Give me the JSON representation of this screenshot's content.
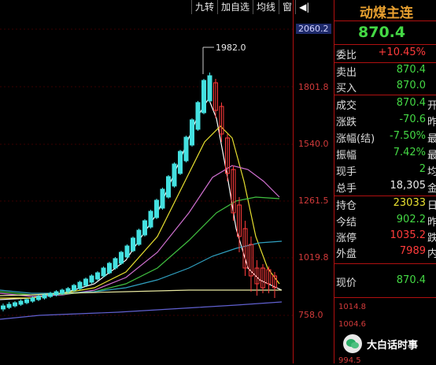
{
  "toolbar": {
    "buttons": [
      "九转",
      "加自选",
      "均线",
      "窗"
    ],
    "arrow": "◀|"
  },
  "axis": {
    "ticks": [
      "2060.2",
      "1801.8",
      "1540.0",
      "1261.5",
      "1019.8",
      "758.0"
    ]
  },
  "chart": {
    "annotation": "1982.0"
  },
  "quote": {
    "title": "动煤主连",
    "price": "870.4",
    "rows": [
      {
        "label": "委比",
        "value": "+10.45%",
        "ext": ""
      },
      {
        "label": "卖出",
        "value": "870.4",
        "ext": ""
      },
      {
        "label": "买入",
        "value": "870.0",
        "ext": ""
      },
      {
        "label": "成交",
        "value": "870.4",
        "ext": "开"
      },
      {
        "label": "涨跌",
        "value": "-70.6",
        "ext": "昨"
      },
      {
        "label": "涨幅(结)",
        "value": "-7.50%",
        "ext": "最"
      },
      {
        "label": "振幅",
        "value": "7.42%",
        "ext": "最"
      },
      {
        "label": "现手",
        "value": "2",
        "ext": "均"
      },
      {
        "label": "总手",
        "value": "18,305",
        "ext": "金"
      },
      {
        "label": "持仓",
        "value": "23033",
        "ext": "日"
      },
      {
        "label": "今结",
        "value": "902.2",
        "ext": "昨"
      },
      {
        "label": "涨停",
        "value": "1035.2",
        "ext": "跌"
      },
      {
        "label": "外盘",
        "value": "7989",
        "ext": "内"
      },
      {
        "label": "现价",
        "value": "870.4",
        "ext": ""
      }
    ]
  },
  "sub_axis": {
    "ticks": [
      "1014.8",
      "1004.6",
      "994.5"
    ]
  },
  "watermark": {
    "text": "大白话时事"
  },
  "colors": {
    "up": "#ff3b3b",
    "down": "#44e0e0",
    "ma5": "#ffffff",
    "ma10": "#e8e030",
    "ma20": "#d070d0",
    "ma40": "#40c040",
    "ma60": "#30a0c0",
    "ma120": "#e8e8a0",
    "ma250": "#6060d0"
  }
}
